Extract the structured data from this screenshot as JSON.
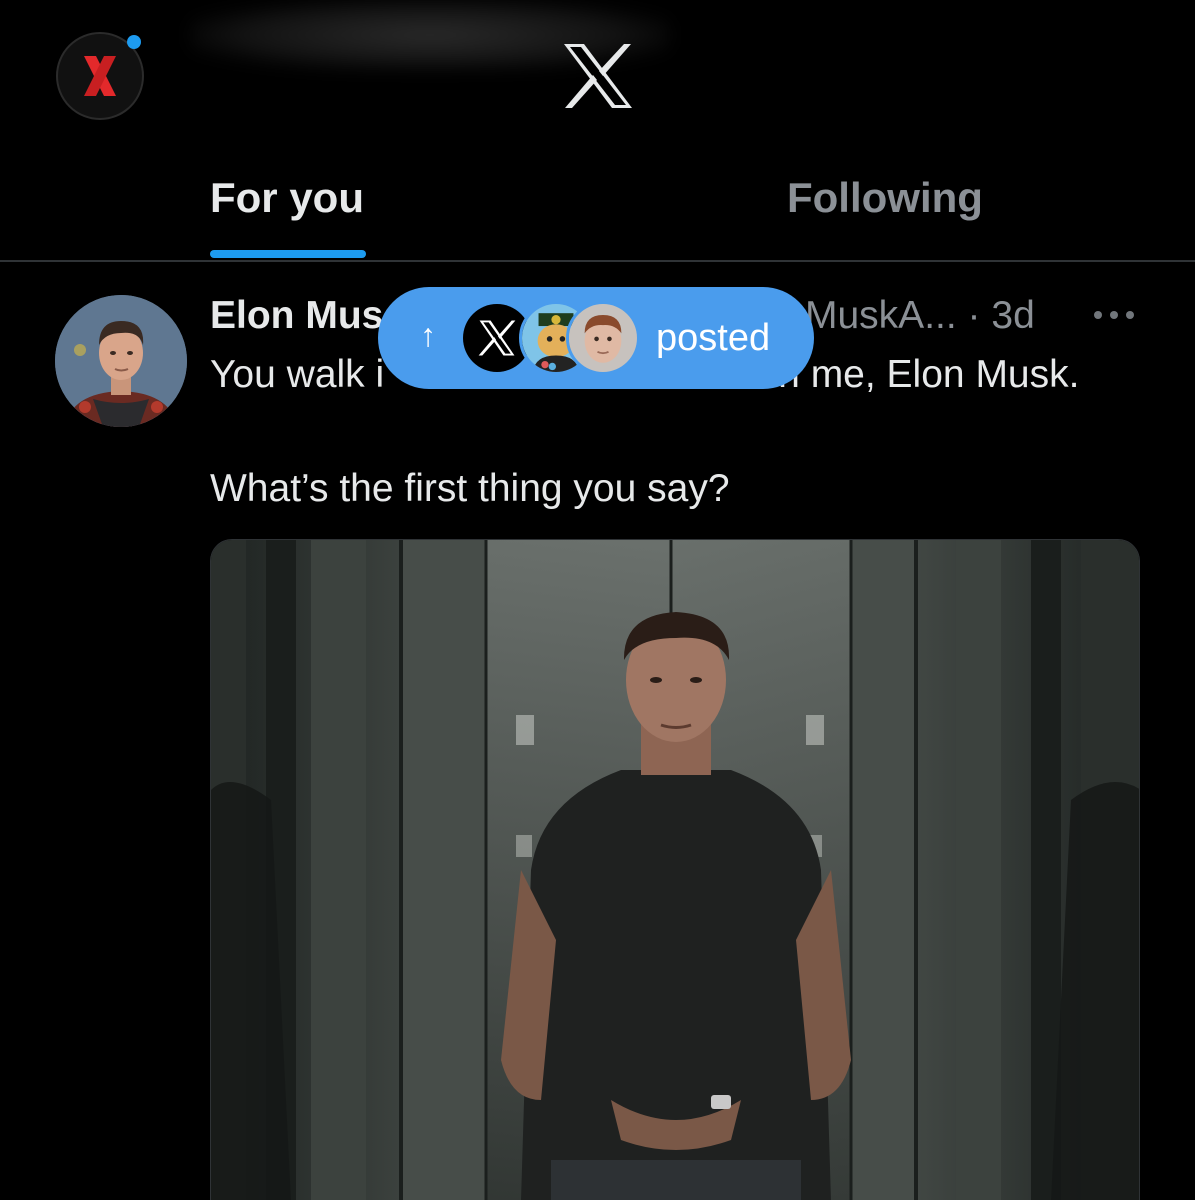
{
  "header": {
    "tabs": [
      {
        "label": "For you",
        "selected": true
      },
      {
        "label": "Following",
        "selected": false
      }
    ],
    "icons": {
      "profile": "profile-avatar-icon",
      "logo": "x-logo-icon",
      "notification_dot": "notification-dot-icon"
    }
  },
  "post": {
    "author_name": "Elon Mus",
    "author_handle": "MuskA...",
    "separator": "·",
    "timestamp": "3d",
    "text_line1_start": "You walk i",
    "text_line1_end": "n me, Elon Musk.",
    "text_line2": "What’s the first thing you say?",
    "more_icon": "more-options-icon"
  },
  "new_posts_pill": {
    "arrow": "↑",
    "label": "posted",
    "avatars": [
      "x-account-avatar",
      "cartoon-avatar",
      "person-avatar"
    ]
  },
  "colors": {
    "accent": "#1d9bf0",
    "pill": "#4a9ced",
    "background": "#000000",
    "text_primary": "#e7e9ea",
    "text_secondary": "#8b9096",
    "divider": "#2f3336"
  }
}
